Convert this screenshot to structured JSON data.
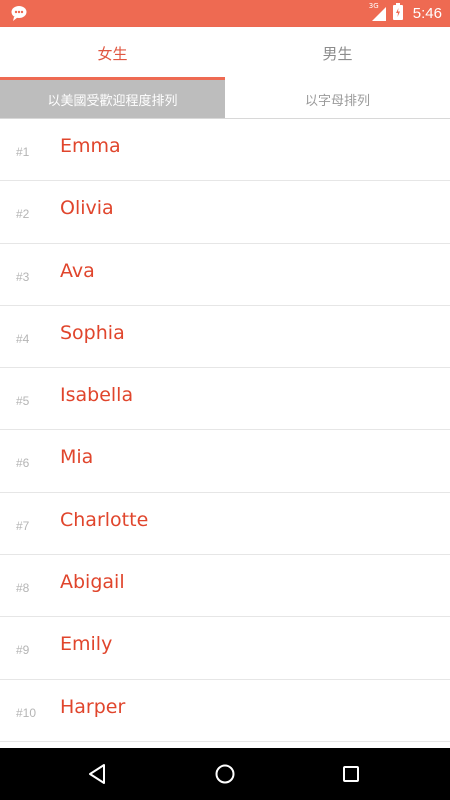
{
  "status": {
    "time": "5:46",
    "network": "3G",
    "icons": [
      "notification-icon",
      "signal-icon",
      "battery-icon"
    ]
  },
  "tabs": [
    {
      "label": "女生",
      "selected": true
    },
    {
      "label": "男生",
      "selected": false
    }
  ],
  "sort": {
    "popularity_label": "以美國受歡迎程度排列",
    "alphabetical_label": "以字母排列",
    "selected": "popularity"
  },
  "names": [
    {
      "rank": "#1",
      "name": "Emma"
    },
    {
      "rank": "#2",
      "name": "Olivia"
    },
    {
      "rank": "#3",
      "name": "Ava"
    },
    {
      "rank": "#4",
      "name": "Sophia"
    },
    {
      "rank": "#5",
      "name": "Isabella"
    },
    {
      "rank": "#6",
      "name": "Mia"
    },
    {
      "rank": "#7",
      "name": "Charlotte"
    },
    {
      "rank": "#8",
      "name": "Abigail"
    },
    {
      "rank": "#9",
      "name": "Emily"
    },
    {
      "rank": "#10",
      "name": "Harper"
    }
  ],
  "navigation": {
    "icons": [
      "back-icon",
      "home-icon",
      "recents-icon"
    ]
  },
  "colors": {
    "accent": "#ee6a52",
    "name_text": "#e0452c",
    "rank_text": "#b5b5b5",
    "selected_sort_bg": "#bdbdbd"
  }
}
